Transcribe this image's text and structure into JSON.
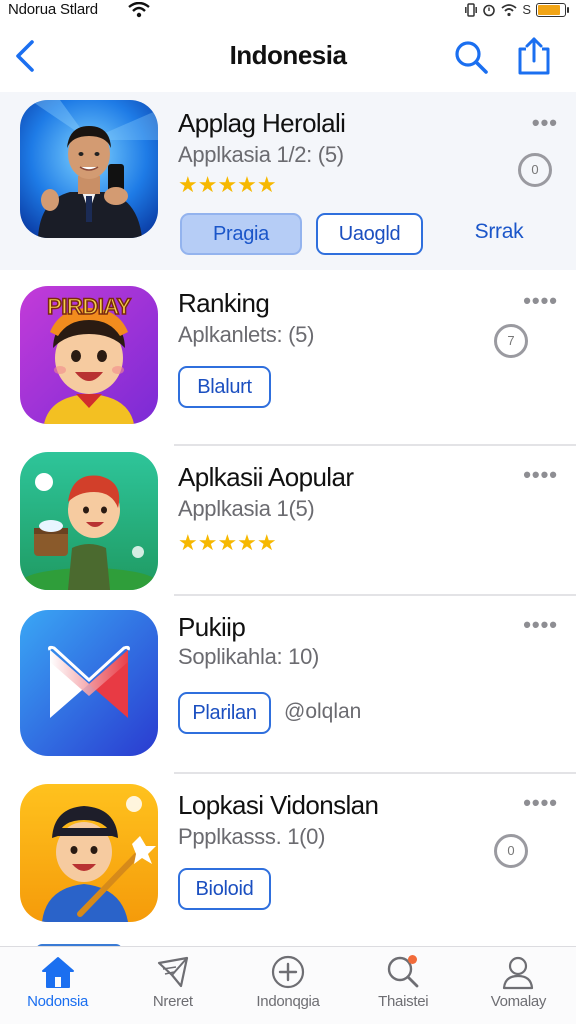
{
  "status_bar": {
    "carrier": "Ndorua Stlard",
    "right_text": "S",
    "battery_level": 0.85
  },
  "nav": {
    "title": "Indonesia",
    "back_icon": "chevron-left-icon",
    "search_icon": "search-icon",
    "share_icon": "share-icon",
    "accent": "#1b6ff0"
  },
  "apps": [
    {
      "name": "Applag Herolali",
      "subtitle": "Applkasia 1/2: (5)",
      "stars": "★★★★★",
      "more": "•••",
      "side_badge": "0",
      "buttons": [
        "Pragia",
        "Uaogld",
        "Srrak"
      ]
    },
    {
      "name": "Ranking",
      "subtitle": "Aplkanlets: (5)",
      "more": "••••",
      "side_badge": "7",
      "buttons": [
        "Blalurt"
      ],
      "icon_text": "PIRDIAY"
    },
    {
      "name": "Aplkasii Aopular",
      "subtitle": "Applkasia 1(5)",
      "stars": "★★★★★",
      "more": "••••"
    },
    {
      "name": "Pukiip",
      "subtitle": "Soplikahla: 10)",
      "more": "••••",
      "buttons": [
        "Plarilan"
      ],
      "extra": "@olqlan"
    },
    {
      "name": "Lopkasi Vidonslan",
      "subtitle": "Ppplkasss. 1(0)",
      "more": "••••",
      "side_badge": "0",
      "buttons": [
        "Bioloid"
      ]
    }
  ],
  "tabs": [
    {
      "label": "Nodonsia",
      "icon": "home-icon",
      "active": true
    },
    {
      "label": "Nreret",
      "icon": "paper-plane-icon",
      "active": false
    },
    {
      "label": "Indonqgia",
      "icon": "plus-circle-icon",
      "active": false
    },
    {
      "label": "Thaistei",
      "icon": "search-icon",
      "active": false,
      "badge_color": "#f26b3a"
    },
    {
      "label": "Vomalay",
      "icon": "person-icon",
      "active": false
    }
  ]
}
